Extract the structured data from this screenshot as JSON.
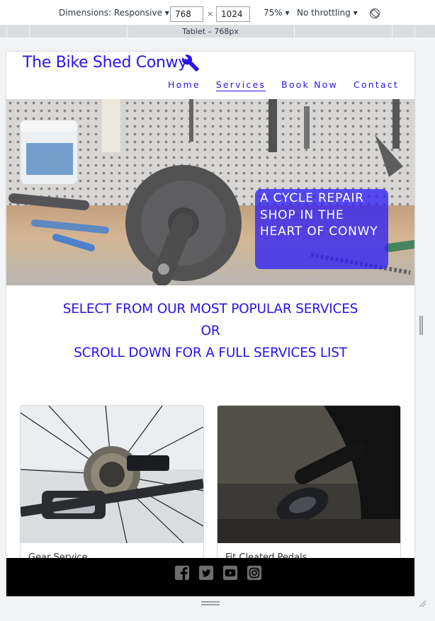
{
  "devtools": {
    "dimensions_label": "Dimensions: Responsive ▾",
    "width": "768",
    "times": "×",
    "height": "1024",
    "zoom": "75% ▾",
    "throttling": "No throttling ▾",
    "media_label": "Tablet – 768px"
  },
  "site": {
    "brand": "The Bike Shed Conwy",
    "nav": [
      {
        "label": "Home"
      },
      {
        "label": "Services",
        "active": true
      },
      {
        "label": "Book Now"
      },
      {
        "label": "Contact"
      }
    ],
    "hero_caption": [
      "A CYCLE REPAIR",
      "SHOP IN THE",
      "HEART OF CONWY"
    ],
    "intro_lines": [
      "SELECT FROM OUR MOST POPULAR SERVICES",
      "OR",
      "SCROLL DOWN FOR A FULL SERVICES LIST"
    ],
    "cards": [
      {
        "title": "Gear Service"
      },
      {
        "title": "Fit Cleated Pedals"
      }
    ],
    "social_icons": [
      "facebook-icon",
      "twitter-icon",
      "youtube-icon",
      "instagram-icon"
    ]
  },
  "colors": {
    "brand_blue": "#2a14e6",
    "caption_bg": "#3020f5",
    "footer_bg": "#000000"
  }
}
